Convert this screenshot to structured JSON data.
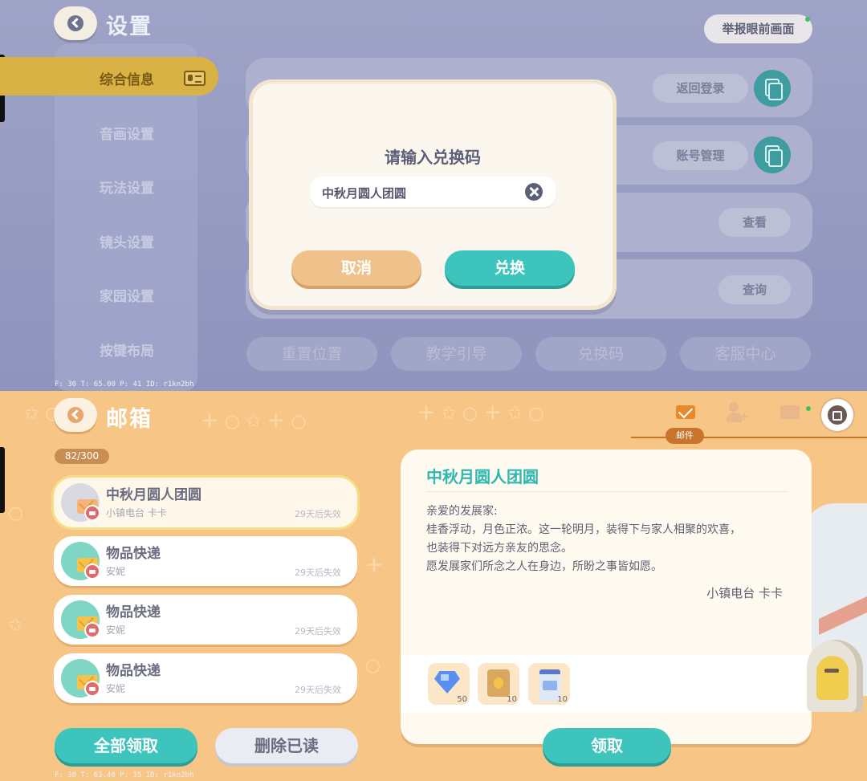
{
  "settings": {
    "title": "设置",
    "report_button": "举报眼前画面",
    "sidebar": [
      {
        "label": "综合信息",
        "active": true
      },
      {
        "label": "音画设置"
      },
      {
        "label": "玩法设置"
      },
      {
        "label": "镜头设置"
      },
      {
        "label": "家园设置"
      },
      {
        "label": "按键布局"
      }
    ],
    "row_buttons": [
      "返回登录",
      "账号管理",
      "查看",
      "查询"
    ],
    "bottom_buttons": [
      "重置位置",
      "教学引导",
      "兑换码",
      "客服中心"
    ],
    "debug": "F: 30    T: 65.00    P: 41    ID: r1kn2bh"
  },
  "redeem_dialog": {
    "title": "请输入兑换码",
    "input_value": "中秋月圆人团圆",
    "cancel_label": "取消",
    "confirm_label": "兑换"
  },
  "mailbox": {
    "title": "邮箱",
    "count": "82/300",
    "active_tab_label": "邮件",
    "mails": [
      {
        "title": "中秋月圆人团圆",
        "sender": "小镇电台 卡卡",
        "expires": "29天后失效",
        "selected": true
      },
      {
        "title": "物品快递",
        "sender": "安妮",
        "expires": "29天后失效"
      },
      {
        "title": "物品快递",
        "sender": "安妮",
        "expires": "29天后失效"
      },
      {
        "title": "物品快递",
        "sender": "安妮",
        "expires": "29天后失效"
      }
    ],
    "detail": {
      "title": "中秋月圆人团圆",
      "lines": [
        "亲爱的发展家:",
        "桂香浮动，月色正浓。这一轮明月，装得下与家人相聚的欢喜，",
        "也装得下对远方亲友的思念。",
        "愿发展家们所念之人在身边，所盼之事皆如愿。"
      ],
      "signature": "小镇电台 卡卡",
      "attachments": [
        {
          "icon": "gem-icon",
          "qty": "50"
        },
        {
          "icon": "seed-bag-icon",
          "qty": "10"
        },
        {
          "icon": "milk-carton-icon",
          "qty": "10"
        }
      ]
    },
    "claim_all_label": "全部领取",
    "delete_read_label": "删除已读",
    "claim_label": "领取",
    "debug": "F: 30    T: 63.40    P: 35    ID: r1kn2bh"
  },
  "colors": {
    "accent_teal": "#3dc4bc",
    "accent_orange": "#eec28a",
    "sidebar_active": "#d9b245"
  }
}
